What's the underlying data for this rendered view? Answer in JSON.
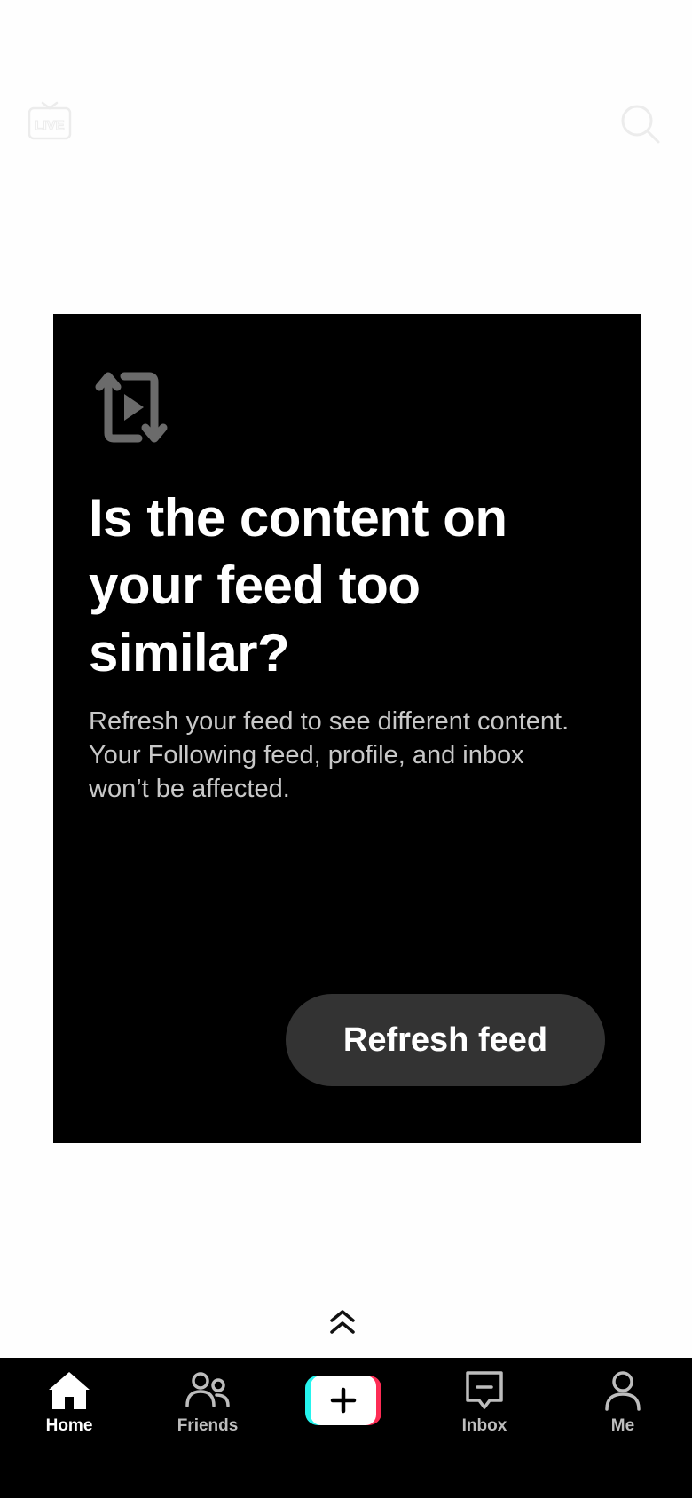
{
  "top_bar": {
    "live_icon": "live-tv-icon",
    "search_icon": "search-icon"
  },
  "card": {
    "icon": "refresh-feed-icon",
    "title": "Is the content on your feed too similar?",
    "description": "Refresh your feed to see different content. Your Following feed, profile, and inbox won’t be affected.",
    "button_label": "Refresh feed"
  },
  "swipe_hint_icon": "double-chevron-up-icon",
  "bottom_nav": {
    "items": [
      {
        "label": "Home",
        "icon": "home-icon",
        "active": true
      },
      {
        "label": "Friends",
        "icon": "friends-icon",
        "active": false
      },
      {
        "label": "",
        "icon": "plus-icon",
        "active": false
      },
      {
        "label": "Inbox",
        "icon": "inbox-icon",
        "active": false
      },
      {
        "label": "Me",
        "icon": "profile-icon",
        "active": false
      }
    ]
  },
  "colors": {
    "card_bg": "#000000",
    "button_bg": "#333333",
    "accent_cyan": "#25F4EE",
    "accent_red": "#FE2C55"
  }
}
